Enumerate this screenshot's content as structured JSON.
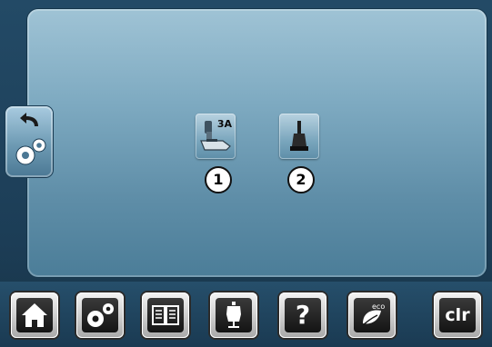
{
  "main": {
    "buttons": [
      {
        "number": "1",
        "tag": "3A",
        "icon": "presser-foot-icon"
      },
      {
        "number": "2",
        "icon": "presser-foot-sole-icon"
      }
    ]
  },
  "side_tab": {
    "icons": [
      "back-arrow-icon",
      "setup-gears-icon"
    ]
  },
  "toolbar": {
    "items": [
      {
        "icon": "home-icon"
      },
      {
        "icon": "setup-gears-icon"
      },
      {
        "icon": "tutorial-book-icon"
      },
      {
        "icon": "dress-form-icon"
      },
      {
        "icon": "help-icon",
        "label": "?"
      },
      {
        "icon": "eco-leaf-icon",
        "label": "eco"
      },
      {
        "icon": "clear-icon",
        "label": "clr"
      }
    ]
  },
  "colors": {
    "panel": "#7eaac1",
    "background": "#1d3b52",
    "toolbar_button": "#141414"
  }
}
